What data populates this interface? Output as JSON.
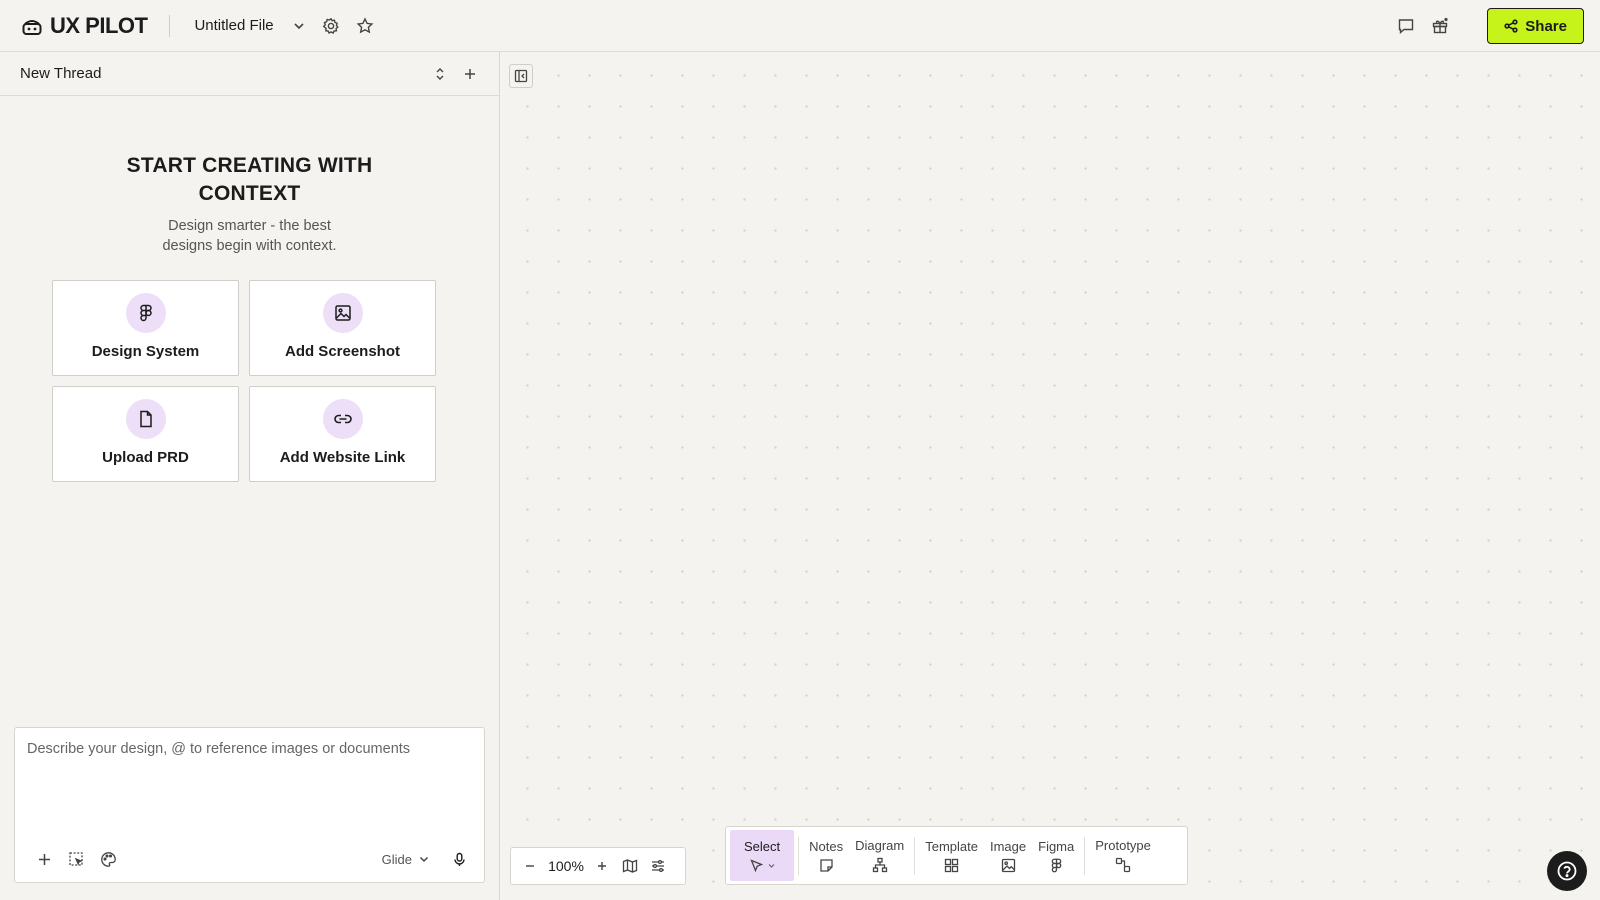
{
  "app": {
    "name": "UX PILOT"
  },
  "file": {
    "name": "Untitled File"
  },
  "header": {
    "share_label": "Share"
  },
  "thread": {
    "title": "New Thread"
  },
  "hero": {
    "title": "START CREATING WITH CONTEXT",
    "subtitle": "Design smarter - the best designs begin with context."
  },
  "context_cards": [
    {
      "label": "Design System",
      "icon": "figma-icon"
    },
    {
      "label": "Add Screenshot",
      "icon": "image-icon"
    },
    {
      "label": "Upload PRD",
      "icon": "file-icon"
    },
    {
      "label": "Add Website Link",
      "icon": "link-icon"
    }
  ],
  "prompt": {
    "placeholder": "Describe your design, @ to reference images or documents",
    "model": "Glide"
  },
  "zoom": {
    "value": "100%"
  },
  "toolbar": {
    "tools": [
      {
        "label": "Select",
        "icon": "cursor-icon",
        "active": true
      },
      {
        "label": "Notes",
        "icon": "note-icon"
      },
      {
        "label": "Diagram",
        "icon": "diagram-icon"
      },
      {
        "label": "Template",
        "icon": "template-icon"
      },
      {
        "label": "Image",
        "icon": "image-icon"
      },
      {
        "label": "Figma",
        "icon": "figma-icon"
      },
      {
        "label": "Prototype",
        "icon": "prototype-icon"
      }
    ]
  },
  "colors": {
    "accent": "#c6f31a",
    "active_tool_bg": "#ead9f7",
    "card_icon_bg": "#ecdff7",
    "background": "#f4f3ef"
  }
}
